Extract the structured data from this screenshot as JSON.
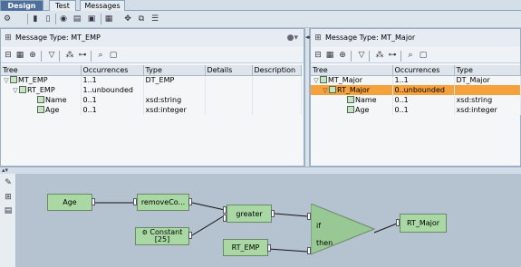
{
  "tabs": [
    {
      "label": "Design"
    },
    {
      "label": "Test"
    },
    {
      "label": "Messages"
    }
  ],
  "left_pane": {
    "title": "Message Type: MT_EMP",
    "columns": [
      "Tree",
      "Occurrences",
      "Type",
      "Details",
      "Description"
    ],
    "rows": [
      {
        "name": "MT_EMP",
        "occ": "1..1",
        "type": "DT_EMP"
      },
      {
        "name": "RT_EMP",
        "occ": "1..unbounded",
        "type": ""
      },
      {
        "name": "Name",
        "occ": "0..1",
        "type": "xsd:string"
      },
      {
        "name": "Age",
        "occ": "0..1",
        "type": "xsd:integer"
      }
    ]
  },
  "right_pane": {
    "title": "Message Type: MT_Major",
    "columns": [
      "Tree",
      "Occurrences",
      "Type"
    ],
    "rows": [
      {
        "name": "MT_Major",
        "occ": "1..1",
        "type": "DT_Major"
      },
      {
        "name": "RT_Major",
        "occ": "0..unbounded",
        "type": ""
      },
      {
        "name": "Name",
        "occ": "0..1",
        "type": "xsd:string"
      },
      {
        "name": "Age",
        "occ": "0..1",
        "type": "xsd:integer"
      }
    ]
  },
  "mapping": {
    "age_box": "Age",
    "remove_box": "removeCo...",
    "greater_box": "greater",
    "constant_box": "Constant",
    "constant_value": "[25]",
    "rt_emp_box": "RT_EMP",
    "if_label": "if",
    "then_label": "then",
    "rt_major_box": "RT_Major"
  }
}
